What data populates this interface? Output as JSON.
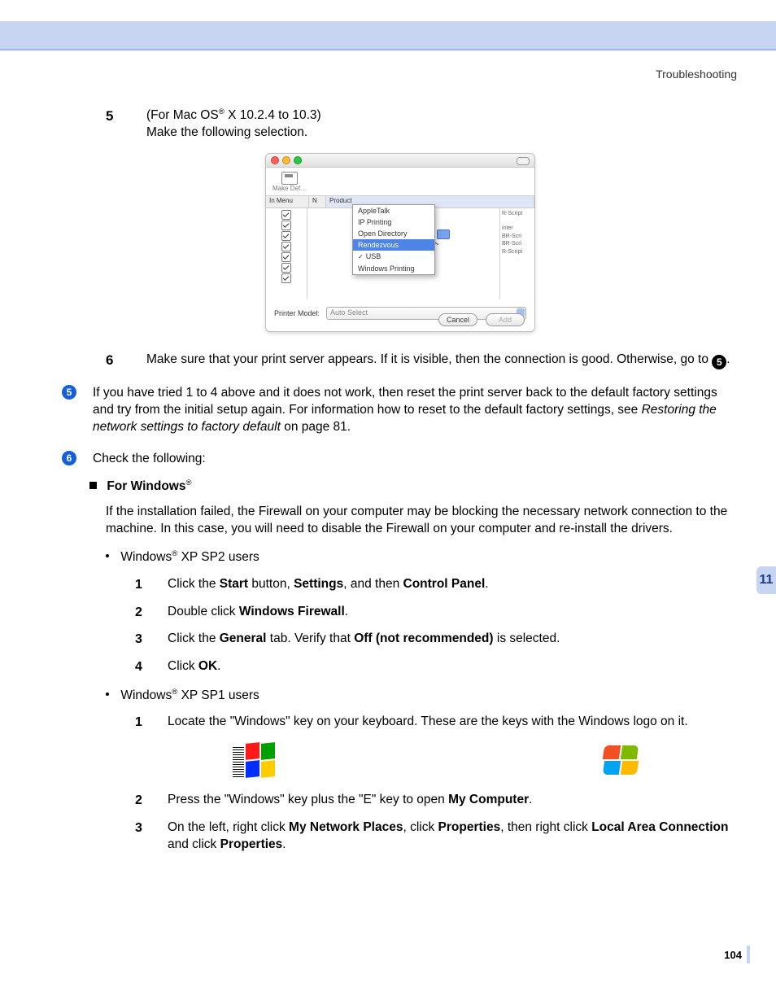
{
  "header": {
    "section": "Troubleshooting"
  },
  "side_tab": "11",
  "page_number": "104",
  "steps": {
    "s5": {
      "num": "5",
      "line1_a": "(For Mac OS",
      "line1_b": " X 10.2.4 to 10.3)",
      "line2": "Make the following selection."
    },
    "s6": {
      "num": "6",
      "text_a": "Make sure that your print server appears. If it is visible, then the connection is good. Otherwise, go to ",
      "text_b": "."
    }
  },
  "circ5": {
    "num": "5",
    "text_a": "If you have tried 1 to 4 above and it does not work, then reset the print server back to the default factory settings and try from the initial setup again. For information how to reset to the default factory settings, see ",
    "italic": "Restoring the network settings to factory default",
    "text_b": " on page 81."
  },
  "circ6": {
    "num": "6",
    "intro": "Check the following:",
    "for_windows": "For Windows",
    "para": "If the installation failed, the Firewall on your computer may be blocking the necessary network connection to the machine. In this case, you will need to disable the Firewall on your computer and re-install the drivers.",
    "sp2_label_a": "Windows",
    "sp2_label_b": " XP SP2 users",
    "sp2": {
      "1": {
        "n": "1",
        "a": "Click the ",
        "b1": "Start",
        "c": " button, ",
        "b2": "Settings",
        "d": ", and then ",
        "b3": "Control Panel",
        "e": "."
      },
      "2": {
        "n": "2",
        "a": "Double click ",
        "b1": "Windows Firewall",
        "c": "."
      },
      "3": {
        "n": "3",
        "a": "Click the ",
        "b1": "General",
        "c": " tab. Verify that ",
        "b2": "Off (not recommended)",
        "d": " is selected."
      },
      "4": {
        "n": "4",
        "a": "Click ",
        "b1": "OK",
        "c": "."
      }
    },
    "sp1_label_a": "Windows",
    "sp1_label_b": " XP SP1 users",
    "sp1": {
      "1": {
        "n": "1",
        "a": "Locate the \"Windows\" key on your keyboard. These are the keys with the Windows logo on it."
      },
      "2": {
        "n": "2",
        "a": "Press the \"Windows\" key plus the \"E\" key to open ",
        "b1": "My Computer",
        "c": "."
      },
      "3": {
        "n": "3",
        "a": "On the left, right click ",
        "b1": "My Network Places",
        "c": ", click ",
        "b2": "Properties",
        "d": ", then right click ",
        "b3": "Local Area Connection",
        "e": " and click ",
        "b4": "Properties",
        "f": "."
      }
    }
  },
  "mac": {
    "make_default": "Make Def…",
    "in_menu": "In Menu",
    "n": "N",
    "product": "Product",
    "right_lines": [
      "R-Script",
      "inter",
      "BR-Scri",
      "BR-Scri",
      "R-Script"
    ],
    "printer_model_label": "Printer Model:",
    "printer_model_value": "Auto Select",
    "cancel": "Cancel",
    "add": "Add",
    "menu": {
      "appletalk": "AppleTalk",
      "ip": "IP Printing",
      "opendir": "Open Directory",
      "rendezvous": "Rendezvous",
      "usb": "USB",
      "windows": "Windows Printing"
    }
  },
  "reg": "®"
}
